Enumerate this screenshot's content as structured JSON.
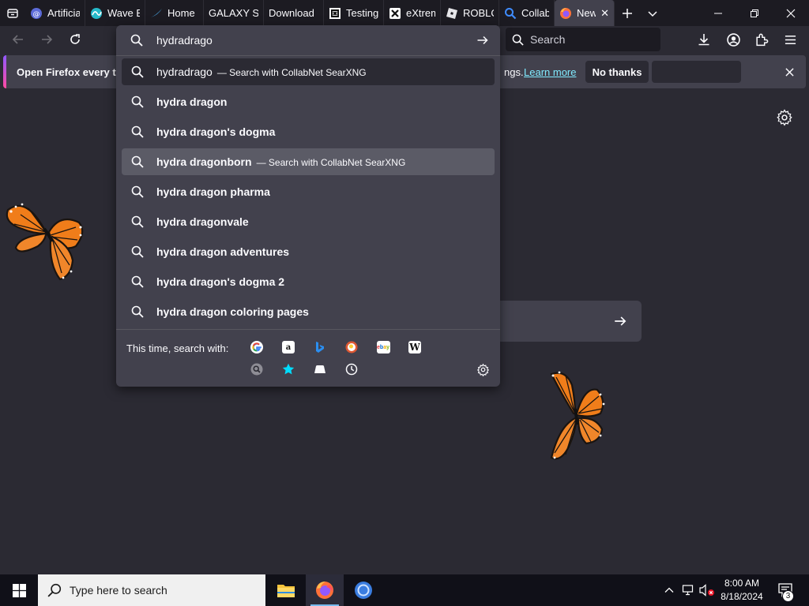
{
  "tabs": [
    {
      "title": "Artificia",
      "icon": "ai-icon"
    },
    {
      "title": "Wave B",
      "icon": "wave-icon"
    },
    {
      "title": "Home",
      "icon": "swoosh-icon"
    },
    {
      "title": "GALAXY SW",
      "icon": ""
    },
    {
      "title": "Download",
      "icon": ""
    },
    {
      "title": "Testing",
      "icon": "puzzle-icon"
    },
    {
      "title": "eXtrem",
      "icon": "x-icon"
    },
    {
      "title": "ROBLO",
      "icon": "roblox-icon"
    },
    {
      "title": "Collab",
      "icon": "search-icon"
    },
    {
      "title": "New",
      "icon": "firefox-icon",
      "active": true
    }
  ],
  "toolbar": {
    "search_placeholder": "Search"
  },
  "urlbar": {
    "value": "hydradrago",
    "results": [
      {
        "bold": "",
        "plain": "hydradrago",
        "action": "— Search with CollabNet SearXNG",
        "highlight": "dark"
      },
      {
        "bold": "hydra dragon",
        "plain": "",
        "action": "",
        "highlight": ""
      },
      {
        "bold": "hydra dragon's dogma",
        "plain": "",
        "action": "",
        "highlight": ""
      },
      {
        "bold": "hydra dragonborn",
        "plain": "",
        "action": "— Search with CollabNet SearXNG",
        "highlight": "light"
      },
      {
        "bold": "hydra dragon pharma",
        "plain": "",
        "action": "",
        "highlight": ""
      },
      {
        "bold": "hydra dragonvale",
        "plain": "",
        "action": "",
        "highlight": ""
      },
      {
        "bold": "hydra dragon adventures",
        "plain": "",
        "action": "",
        "highlight": ""
      },
      {
        "bold": "hydra dragon's dogma 2",
        "plain": "",
        "action": "",
        "highlight": ""
      },
      {
        "bold": "hydra dragon coloring pages",
        "plain": "",
        "action": "",
        "highlight": ""
      }
    ],
    "oneoff_label": "This time, search with:"
  },
  "notification": {
    "text": "Open Firefox every tim",
    "tail": "ngs.",
    "learn_more": "Learn more",
    "no_thanks": "No thanks"
  },
  "taskbar": {
    "search_placeholder": "Type here to search",
    "time": "8:00 AM",
    "date": "8/18/2024",
    "notification_count": "3"
  },
  "colors": {
    "accent_purple": "#9059ff",
    "accent_pink": "#ff4aa2",
    "link": "#80ebff",
    "butterfly_orange": "#f07d1a"
  }
}
